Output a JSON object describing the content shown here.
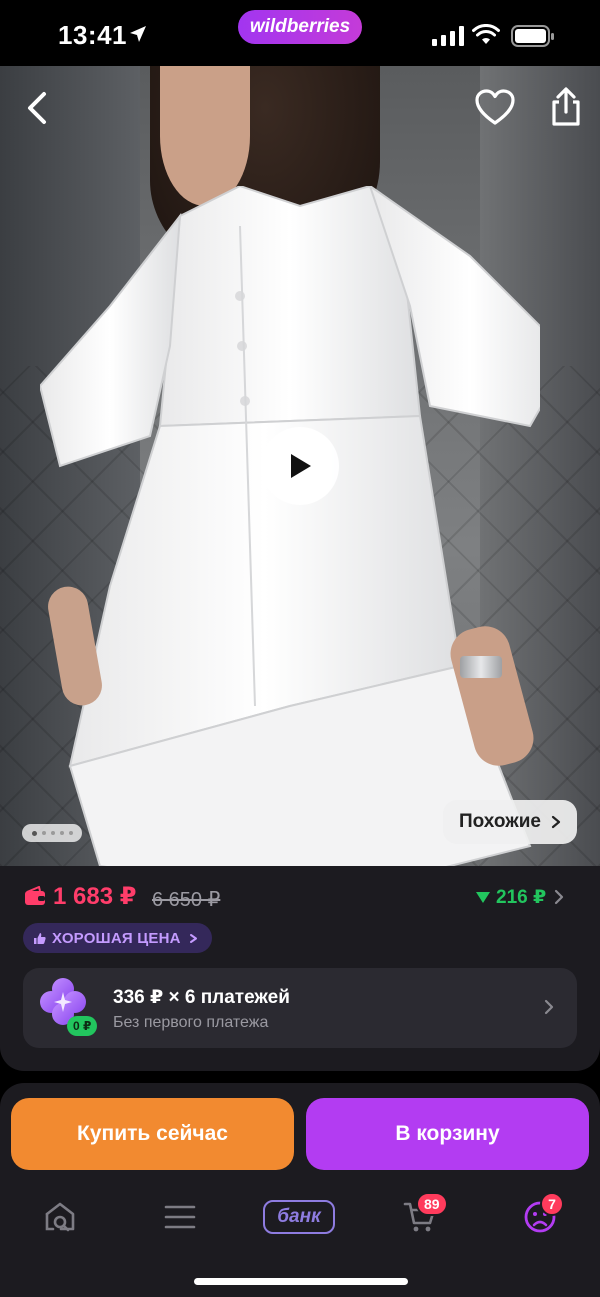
{
  "status_bar": {
    "time": "13:41",
    "brand": "wildberries"
  },
  "hero": {
    "similar_label": "Похожие",
    "image_count": 5,
    "active_image": 1
  },
  "product": {
    "price": "1 683 ₽",
    "old_price": "6 650 ₽",
    "cashback": "216 ₽",
    "badge": "ХОРОШАЯ ЦЕНА",
    "installment": {
      "title": "336 ₽ × 6 платежей",
      "subtitle": "Без первого платежа",
      "zero_label": "0 ₽"
    }
  },
  "actions": {
    "buy_now": "Купить сейчас",
    "add_to_cart": "В корзину"
  },
  "tabbar": {
    "bank_label": "банк",
    "cart_count": "89",
    "profile_count": "7"
  },
  "colors": {
    "brand_purple": "#b33cf2",
    "buy_orange": "#f28a30",
    "price_red": "#ff3d6a",
    "cashback_green": "#22c55e",
    "badge_text": "#c49bff"
  },
  "icons": [
    "back-arrow-icon",
    "heart-icon",
    "share-icon",
    "play-icon",
    "chevron-right-icon",
    "wallet-icon",
    "thumbs-up-icon",
    "sparkle-icon",
    "home-search-icon",
    "menu-icon",
    "cart-icon",
    "profile-icon"
  ]
}
